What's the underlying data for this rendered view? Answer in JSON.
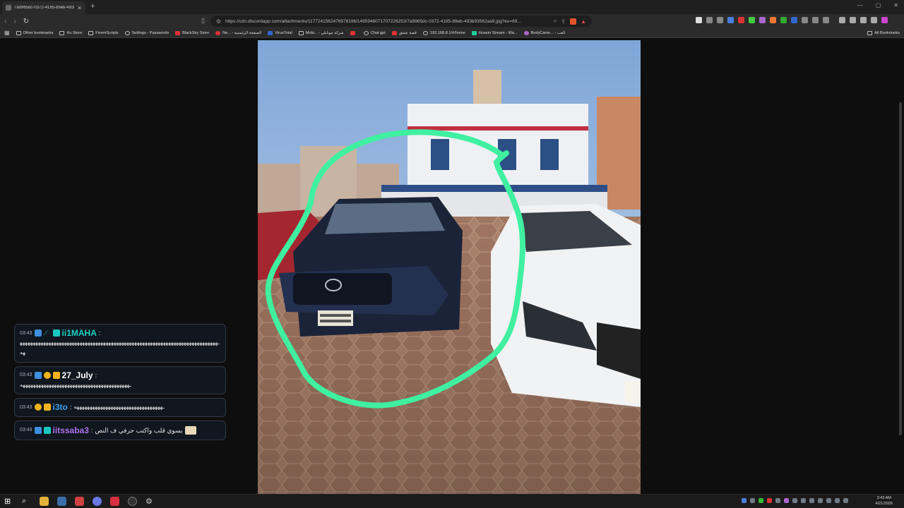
{
  "browser": {
    "tab_title": "7a9965dc-0372-4185-89eb-493b...",
    "url": "https://cdn.discordapp.com/attachments/1177241562476978196/1495946071707226253/7a9965dc-0372-4185-89eb-493b93562aa9.jpg?ex=69...",
    "profile_label": "21",
    "bookmarks": [
      {
        "label": "Other bookmarks",
        "icon": "folder-icon"
      },
      {
        "label": "Ko Store",
        "icon": "folder-icon"
      },
      {
        "label": "FivemScripts",
        "icon": "folder-icon"
      },
      {
        "label": "Settings - Passwords",
        "icon": "gear-icon"
      },
      {
        "label": "BlackSky Store",
        "icon": "store-icon"
      },
      {
        "label": "Ne... - الصفحة الرئيسية",
        "icon": "site-icon"
      },
      {
        "label": "VirusTotal",
        "icon": "virustotal-icon"
      },
      {
        "label": "Mobi... - شركة موبايلي",
        "icon": "mobily-icon"
      },
      {
        "label": "",
        "icon": "youtube-icon"
      },
      {
        "label": "Chat gpt",
        "icon": "chatgpt-icon"
      },
      {
        "label": "قصة عشق",
        "icon": "site-icon"
      },
      {
        "label": "192.168.8.1/#/home",
        "icon": "globe-icon"
      },
      {
        "label": "Husein Stream - Wa...",
        "icon": "kick-icon"
      },
      {
        "label": "BodyCame... - العب",
        "icon": "site-icon"
      }
    ],
    "all_bookmarks": "All Bookmarks"
  },
  "chat": {
    "messages": [
      {
        "time": "03:43",
        "username": "ii1MAHA",
        "username_color": "#17d1c4",
        "badges": [
          "blue",
          "teal-slash",
          "teal"
        ],
        "separator": ":",
        "text": "ـهههههههههههههههههههههههههههههههههههههههههههههههههههههههههههههههههههههههههههههه"
      },
      {
        "time": "03:43",
        "username": "27_July",
        "username_color": "#ffffff",
        "badges": [
          "blue",
          "gold-one",
          "crown"
        ],
        "separator": ":",
        "text": "ـهههههههههههههههههههههههههههههههههههههههههه"
      },
      {
        "time": "03:43",
        "username": "i3to",
        "username_color": "#3aa0f0",
        "badges": [
          "gold-one",
          "crown"
        ],
        "separator": ":",
        "text": "ـهههههههههههههههههههههههههههههههههه"
      },
      {
        "time": "03:43",
        "username": "iitssaba3",
        "username_color": "#b070f0",
        "badges": [
          "blue",
          "teal"
        ],
        "separator": ":",
        "text": "بسوي قلب واكتب حرفي ف النص"
      }
    ]
  },
  "taskbar": {
    "time": "3:43 AM",
    "date": "4/21/2026",
    "icons": [
      "windows-icon",
      "search-icon",
      "file-explorer-icon",
      "steam-icon",
      "app-icon",
      "discord-icon",
      "valorant-icon",
      "obs-icon",
      "settings-icon"
    ]
  },
  "colors": {
    "highlight_stroke": "#3ff0a0",
    "chat_bg": "#101820"
  }
}
